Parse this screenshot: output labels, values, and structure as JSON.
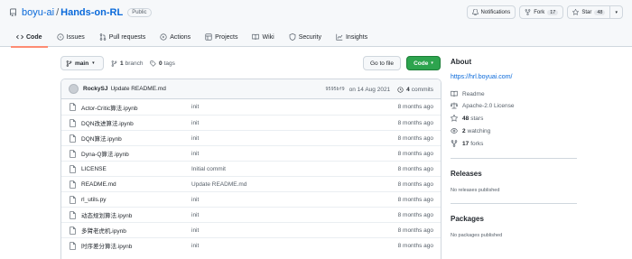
{
  "repo": {
    "owner": "boyu-ai",
    "slash": "/",
    "name": "Hands-on-RL",
    "visibility": "Public"
  },
  "actions": {
    "notifications": "Notifications",
    "fork_label": "Fork",
    "fork_count": "17",
    "star_label": "Star",
    "star_count": "48"
  },
  "tabs": [
    {
      "label": "Code",
      "icon": "code-icon",
      "active": true
    },
    {
      "label": "Issues",
      "icon": "issue-icon"
    },
    {
      "label": "Pull requests",
      "icon": "pull-request-icon"
    },
    {
      "label": "Actions",
      "icon": "play-icon"
    },
    {
      "label": "Projects",
      "icon": "table-icon"
    },
    {
      "label": "Wiki",
      "icon": "book-icon"
    },
    {
      "label": "Security",
      "icon": "shield-icon"
    },
    {
      "label": "Insights",
      "icon": "graph-icon"
    }
  ],
  "filenav": {
    "branch": "main",
    "branch_count": "1",
    "branch_word": "branch",
    "tag_count": "0",
    "tag_word": "tags",
    "goto_file": "Go to file",
    "code_button": "Code"
  },
  "commit": {
    "author": "RockySJ",
    "message": "Update README.md",
    "sha": "9595bf9",
    "date": "on 14 Aug 2021",
    "commit_count": "4",
    "commit_word": "commits"
  },
  "files": [
    {
      "name": "Actor-Critic算法.ipynb",
      "message": "init",
      "age": "8 months ago"
    },
    {
      "name": "DQN改进算法.ipynb",
      "message": "init",
      "age": "8 months ago"
    },
    {
      "name": "DQN算法.ipynb",
      "message": "init",
      "age": "8 months ago"
    },
    {
      "name": "Dyna-Q算法.ipynb",
      "message": "init",
      "age": "8 months ago"
    },
    {
      "name": "LICENSE",
      "message": "Initial commit",
      "age": "8 months ago"
    },
    {
      "name": "README.md",
      "message": "Update README.md",
      "age": "8 months ago"
    },
    {
      "name": "rl_utils.py",
      "message": "init",
      "age": "8 months ago"
    },
    {
      "name": "动态规划算法.ipynb",
      "message": "init",
      "age": "8 months ago"
    },
    {
      "name": "多臂老虎机.ipynb",
      "message": "init",
      "age": "8 months ago"
    },
    {
      "name": "时序差分算法.ipynb",
      "message": "init",
      "age": "8 months ago"
    }
  ],
  "about": {
    "heading": "About",
    "url": "https://hrl.boyuai.com/",
    "readme": "Readme",
    "license": "Apache-2.0 License",
    "stars_count": "48",
    "stars_word": "stars",
    "watching_count": "2",
    "watching_word": "watching",
    "forks_count": "17",
    "forks_word": "forks"
  },
  "releases": {
    "heading": "Releases",
    "empty": "No releases published"
  },
  "packages": {
    "heading": "Packages",
    "empty": "No packages published"
  },
  "colors": {
    "link": "#0969da",
    "active_tab_underline": "#fd8c73",
    "code_button": "#2da44e",
    "header_bg": "#f6f8fa"
  }
}
